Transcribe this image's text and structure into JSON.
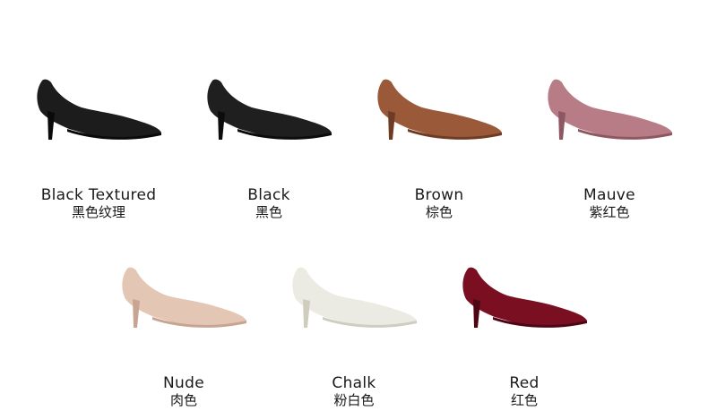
{
  "colors": [
    {
      "en": "Black Textured",
      "cn": "黑色纹理",
      "color": "#1c1c1c",
      "shade": "#0a0a0a",
      "icon": "pump-shoe-icon"
    },
    {
      "en": "Black",
      "cn": "黑色",
      "color": "#1f1f1f",
      "shade": "#0c0c0c",
      "icon": "pump-shoe-icon"
    },
    {
      "en": "Brown",
      "cn": "棕色",
      "color": "#9a5a3a",
      "shade": "#6e3c24",
      "icon": "pump-shoe-icon"
    },
    {
      "en": "Mauve",
      "cn": "紫红色",
      "color": "#b87c86",
      "shade": "#8e5862",
      "icon": "pump-shoe-icon"
    },
    {
      "en": "Nude",
      "cn": "肉色",
      "color": "#e3c6b4",
      "shade": "#c8a592",
      "icon": "pump-shoe-icon"
    },
    {
      "en": "Chalk",
      "cn": "粉白色",
      "color": "#ecebe3",
      "shade": "#cfccc0",
      "icon": "pump-shoe-icon"
    },
    {
      "en": "Red",
      "cn": "红色",
      "color": "#7a0f22",
      "shade": "#4e0614",
      "icon": "pump-shoe-icon"
    }
  ]
}
